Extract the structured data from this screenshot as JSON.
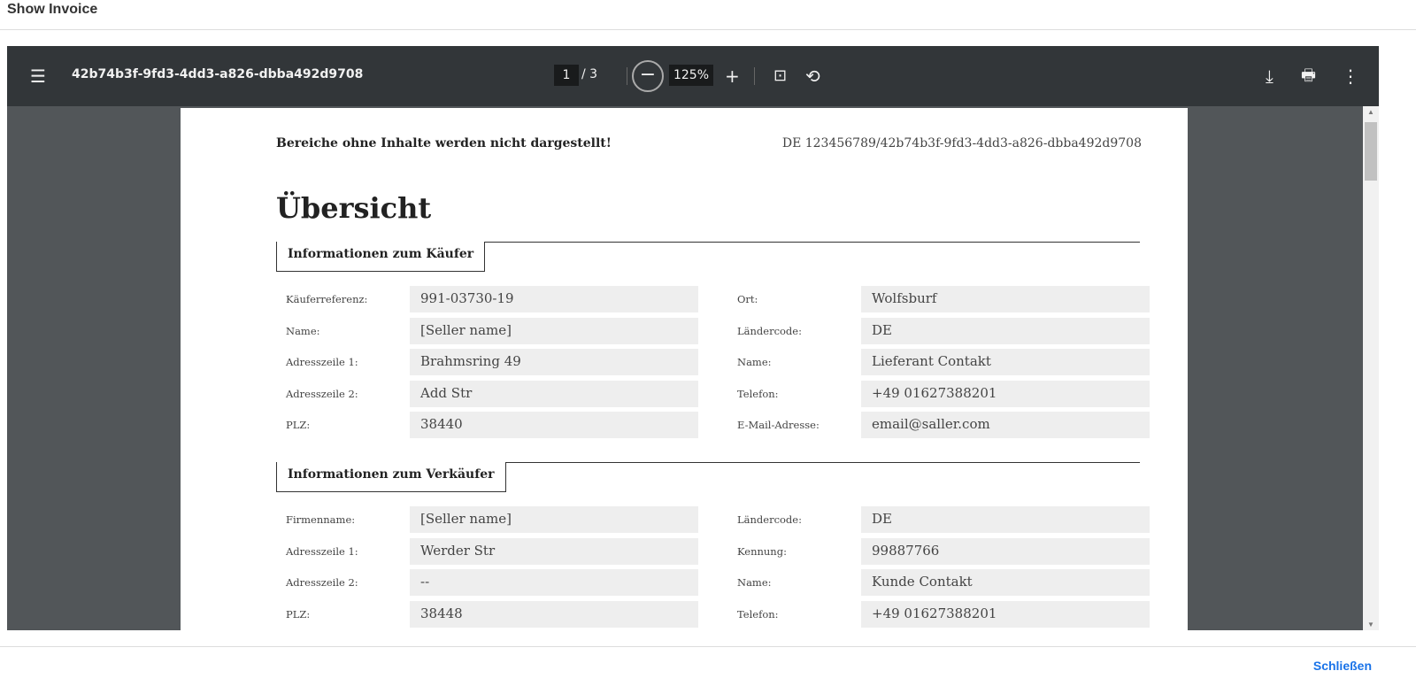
{
  "dialog": {
    "title": "Show Invoice",
    "close_label": "Schließen"
  },
  "toolbar": {
    "doc_title": "42b74b3f-9fd3-4dd3-a826-dbba492d9708",
    "page": "1",
    "page_sep": "/ 3",
    "zoom": "125%"
  },
  "page": {
    "note": "Bereiche ohne Inhalte werden nicht dargestellt!",
    "ref": "DE 123456789/42b74b3f-9fd3-4dd3-a826-dbba492d9708",
    "title": "Übersicht",
    "sections": [
      {
        "title": "Informationen zum Käufer",
        "left": [
          {
            "label": "Käuferreferenz:",
            "value": "991-03730-19"
          },
          {
            "label": "Name:",
            "value": "[Seller name]"
          },
          {
            "label": "Adresszeile 1:",
            "value": "Brahmsring 49"
          },
          {
            "label": "Adresszeile 2:",
            "value": "Add Str"
          },
          {
            "label": "PLZ:",
            "value": "38440"
          }
        ],
        "right": [
          {
            "label": "Ort:",
            "value": "Wolfsburf"
          },
          {
            "label": "Ländercode:",
            "value": "DE"
          },
          {
            "label": "Name:",
            "value": "Lieferant Contakt"
          },
          {
            "label": "Telefon:",
            "value": "+49 01627388201"
          },
          {
            "label": "E-Mail-Adresse:",
            "value": "email@saller.com"
          }
        ]
      },
      {
        "title": "Informationen zum Verkäufer",
        "left": [
          {
            "label": "Firmenname:",
            "value": "[Seller name]"
          },
          {
            "label": "Adresszeile 1:",
            "value": "Werder Str"
          },
          {
            "label": "Adresszeile 2:",
            "value": "--"
          },
          {
            "label": "PLZ:",
            "value": "38448"
          }
        ],
        "right": [
          {
            "label": "Ländercode:",
            "value": "DE"
          },
          {
            "label": "Kennung:",
            "value": "99887766"
          },
          {
            "label": "Name:",
            "value": "Kunde Contakt"
          },
          {
            "label": "Telefon:",
            "value": "+49 01627388201"
          }
        ]
      }
    ]
  }
}
